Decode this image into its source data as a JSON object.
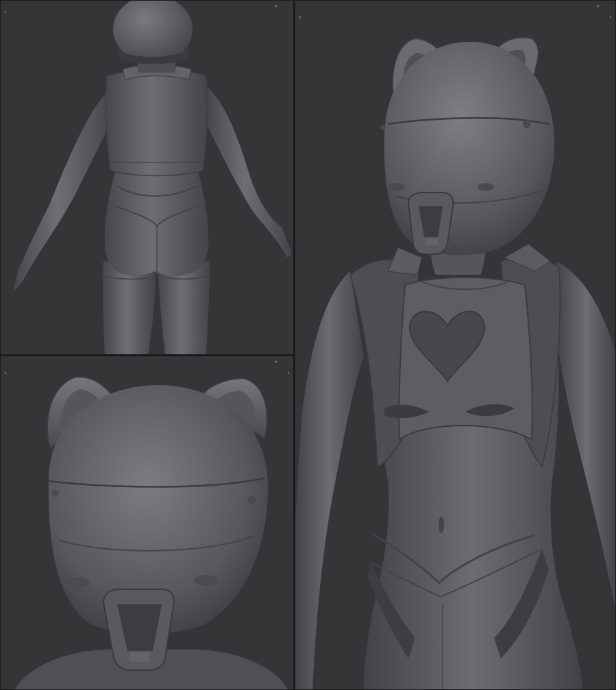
{
  "viewports": [
    {
      "id": "back",
      "view": "back",
      "icons": [
        "chevron-right-icon",
        "chevron-down-icon",
        "chevron-left-icon"
      ]
    },
    {
      "id": "head",
      "view": "head-closeup",
      "icons": [
        "chevron-right-icon",
        "chevron-down-icon",
        "chevron-left-icon"
      ]
    },
    {
      "id": "front",
      "view": "front",
      "icons": [
        "chevron-right-icon",
        "chevron-down-icon",
        "chevron-left-icon"
      ]
    }
  ],
  "colors": {
    "background": "#353538",
    "model": "#5d5d61",
    "model_highlight": "#76767b",
    "model_shadow": "#3f3f43",
    "control": "#9c9ca0"
  },
  "glyphs": {
    "chevron_right": "›",
    "chevron_down": "⌄",
    "chevron_left": "‹"
  }
}
